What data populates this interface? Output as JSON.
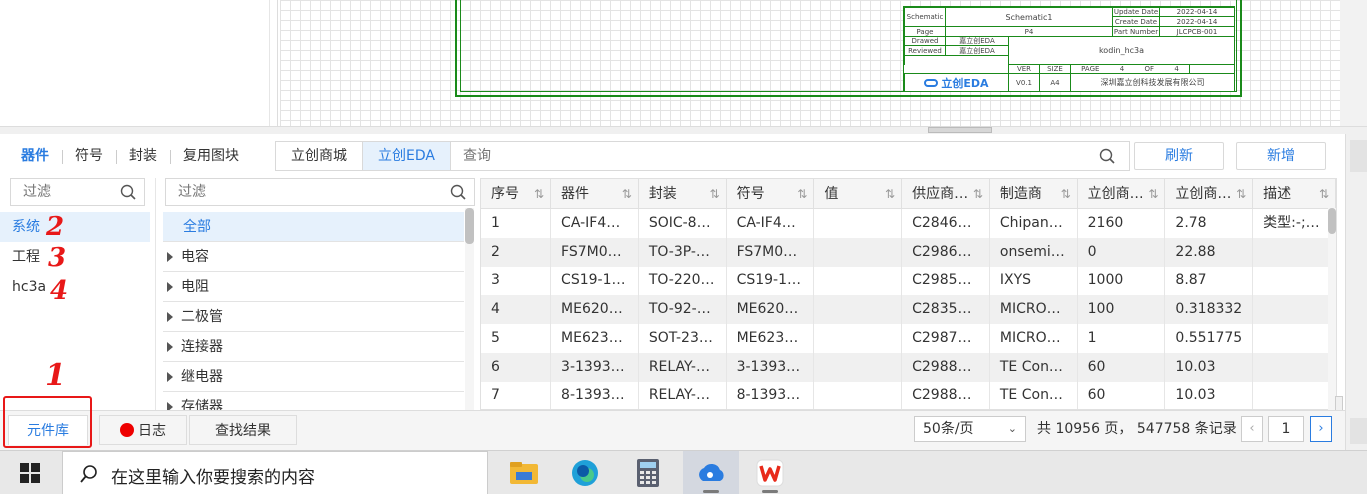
{
  "titleblock": {
    "schematic_label": "Schematic",
    "schematic_name": "Schematic1",
    "update_date_label": "Update Date",
    "update_date": "2022-04-14",
    "create_date_label": "Create Date",
    "create_date": "2022-04-14",
    "page_label": "Page",
    "page_val": "P4",
    "part_number_label": "Part Number",
    "part_number": "JLCPCB-001",
    "drawed_label": "Drawed",
    "drawed_val": "嘉立创EDA",
    "reviewed_label": "Reviewed",
    "reviewed_val": "嘉立创EDA",
    "project_name": "kodin_hc3a",
    "ver_label": "VER",
    "size_label": "SIZE",
    "page2_label": "PAGE",
    "of_label": "OF",
    "ver_val": "V0.1",
    "size_val": "A4",
    "page_num": "4",
    "of_num": "4",
    "logo_text": "立创EDA",
    "company": "深圳嘉立创科技发展有限公司"
  },
  "top_tabs": [
    "器件",
    "符号",
    "封装",
    "复用图块"
  ],
  "source_tabs": [
    "立创商城",
    "立创EDA"
  ],
  "query_placeholder": "查询",
  "refresh_label": "刷新",
  "add_label": "新增",
  "filter_placeholder": "过滤",
  "filter2_placeholder": "过滤",
  "libraries": [
    "系统",
    "工程",
    "hc3a"
  ],
  "categories": [
    "全部",
    "电容",
    "电阻",
    "二极管",
    "连接器",
    "继电器",
    "存储器"
  ],
  "columns": [
    "序号",
    "器件",
    "封装",
    "符号",
    "值",
    "供应商…",
    "制造商",
    "立创商…",
    "立创商…",
    "描述"
  ],
  "rows": [
    [
      "1",
      "CA-IF4…",
      "SOIC-8…",
      "CA-IF4…",
      "",
      "C2846…",
      "Chipan…",
      "2160",
      "2.78",
      "类型:-;…"
    ],
    [
      "2",
      "FS7M0…",
      "TO-3P-…",
      "FS7M0…",
      "",
      "C2986…",
      "onsemi…",
      "0",
      "22.88",
      ""
    ],
    [
      "3",
      "CS19-1…",
      "TO-220…",
      "CS19-1…",
      "",
      "C2985…",
      "IXYS",
      "1000",
      "8.87",
      ""
    ],
    [
      "4",
      "ME620…",
      "TO-92-…",
      "ME620…",
      "",
      "C2835…",
      "MICRO…",
      "100",
      "0.318332",
      ""
    ],
    [
      "5",
      "ME623…",
      "SOT-23…",
      "ME623…",
      "",
      "C2987…",
      "MICRO…",
      "1",
      "0.551775",
      ""
    ],
    [
      "6",
      "3-1393…",
      "RELAY-…",
      "3-1393…",
      "",
      "C2988…",
      "TE Con…",
      "60",
      "10.03",
      ""
    ],
    [
      "7",
      "8-1393…",
      "RELAY-…",
      "8-1393…",
      "",
      "C2988…",
      "TE Con…",
      "60",
      "10.03",
      ""
    ]
  ],
  "bottom_tabs": {
    "library": "元件库",
    "log": "日志",
    "find": "查找结果"
  },
  "pager": {
    "page_size": "50条/页",
    "info": "共 10956 页， 547758 条记录",
    "current": "1"
  },
  "annotations": [
    "1",
    "2",
    "3",
    "4"
  ],
  "taskbar": {
    "search_placeholder": "在这里输入你要搜索的内容",
    "apps": [
      "file-explorer-icon",
      "edge-icon",
      "calculator-icon",
      "lceda-pro-icon",
      "wps-icon"
    ]
  },
  "colors": {
    "accent": "#2a7ce0",
    "sheet_border": "#1a8a1a",
    "annotation": "#e81818",
    "log_dot": "#ee0000"
  }
}
